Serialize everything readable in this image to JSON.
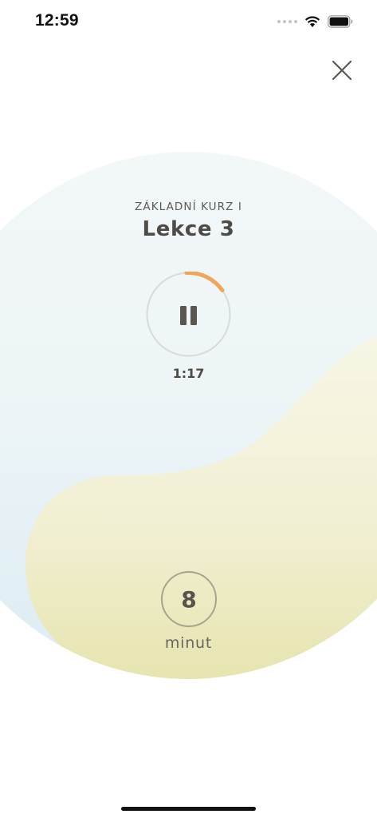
{
  "status_bar": {
    "time": "12:59",
    "icons": [
      "signal-dots-icon",
      "wifi-icon",
      "battery-icon"
    ]
  },
  "header": {
    "close_icon": "close-icon"
  },
  "lesson": {
    "course": "ZÁKLADNÍ KURZ I",
    "title": "Lekce 3"
  },
  "player": {
    "state_icon": "pause-icon",
    "elapsed": "1:17",
    "progress": 0.16,
    "accent_color": "#F0A65A"
  },
  "duration": {
    "value": "8",
    "unit": "minut"
  },
  "colors": {
    "sky": "#EAF4F8",
    "sand": "#EDEBC2",
    "text": "#4E4A45"
  }
}
